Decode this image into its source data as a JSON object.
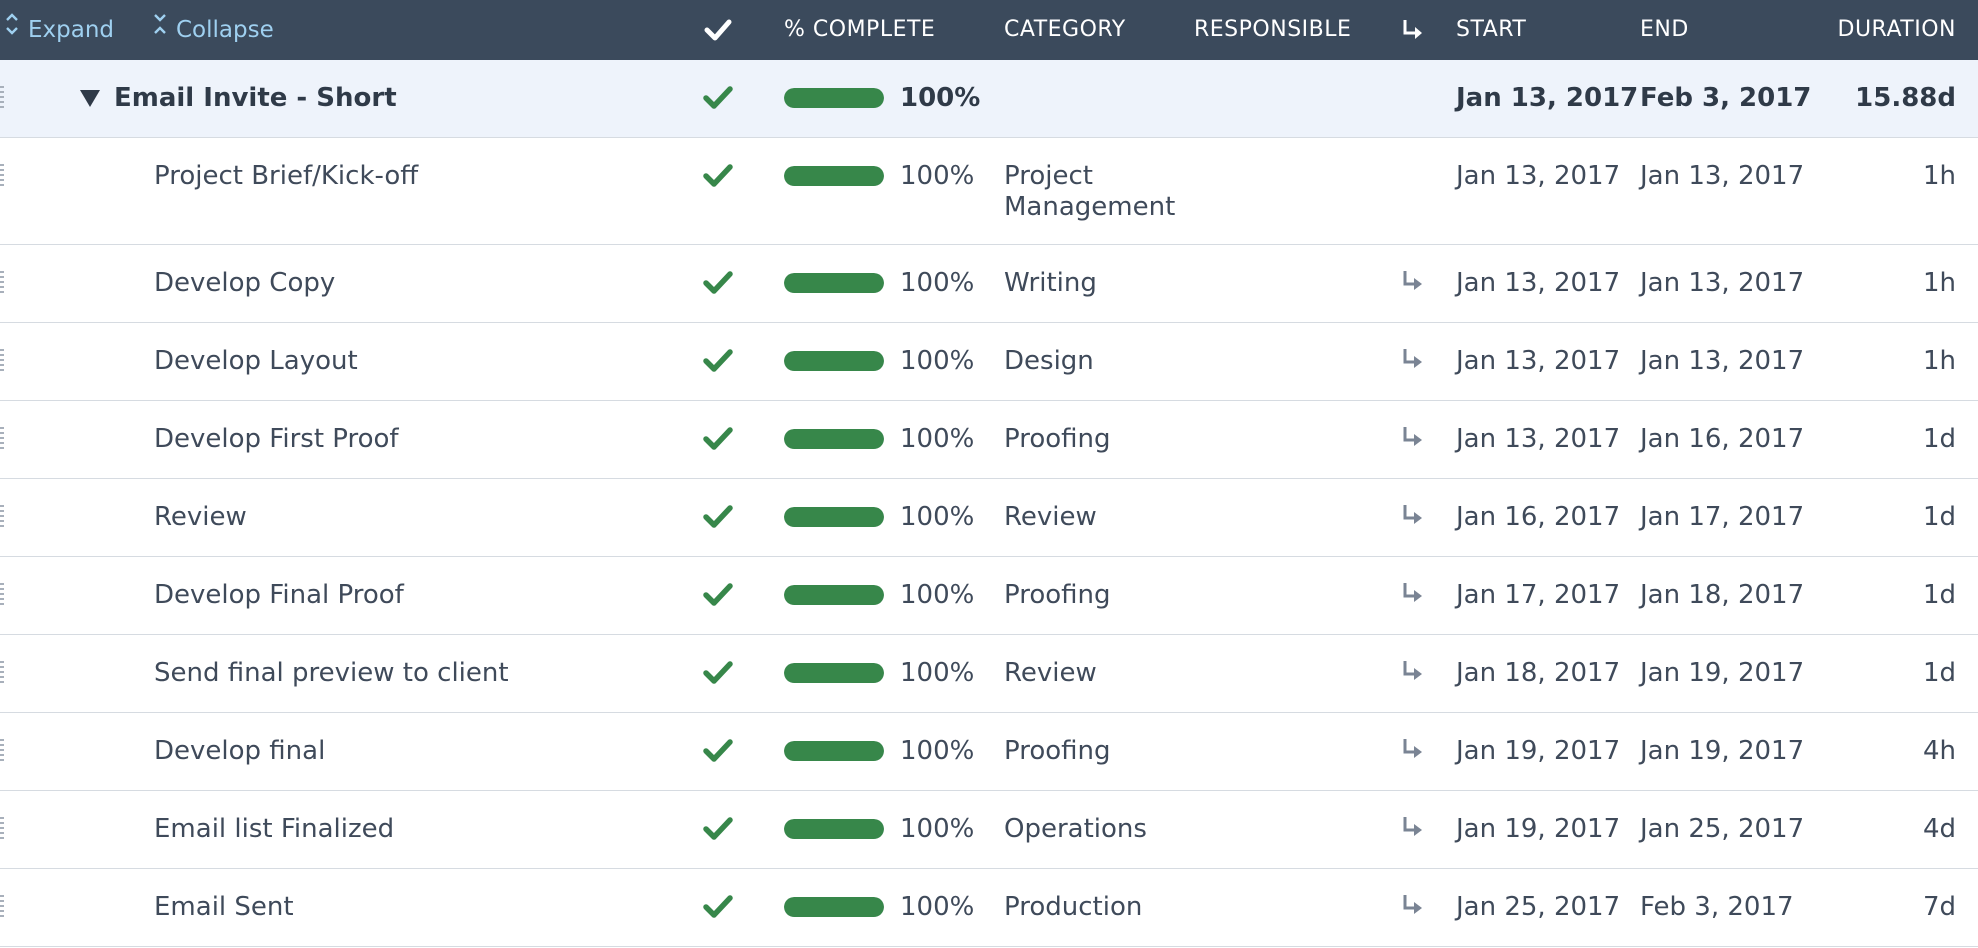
{
  "header": {
    "expand_label": "Expand",
    "collapse_label": "Collapse",
    "columns": {
      "percent_complete": "% COMPLETE",
      "category": "CATEGORY",
      "responsible": "RESPONSIBLE",
      "start": "START",
      "end": "END",
      "duration": "DURATION"
    }
  },
  "colors": {
    "header_bg": "#3b4a5c",
    "header_link": "#9fd0f0",
    "check_green": "#37874a",
    "progress_green": "#37874a",
    "group_row_bg": "#eef3fb",
    "dependency_icon": "#7a8494"
  },
  "icons": {
    "expand": "chevron-up-down-icon",
    "collapse": "chevrons-inward-icon",
    "done_header": "check-icon",
    "dependency_header": "dependency-arrow-icon",
    "row_done": "check-icon",
    "row_dependency": "dependency-arrow-icon",
    "group_toggle": "caret-down-icon"
  },
  "group": {
    "name": "Email Invite - Short",
    "complete": true,
    "progress": 100,
    "progress_label": "100%",
    "start": "Jan 13, 2017",
    "end": "Feb 3, 2017",
    "duration": "15.88d"
  },
  "tasks": [
    {
      "name": "Project Brief/Kick-off",
      "complete": true,
      "progress": 100,
      "progress_label": "100%",
      "category": [
        "Project",
        "Management"
      ],
      "dependency": false,
      "start": "Jan 13, 2017",
      "end": "Jan 13, 2017",
      "duration": "1h"
    },
    {
      "name": "Develop Copy",
      "complete": true,
      "progress": 100,
      "progress_label": "100%",
      "category": [
        "Writing"
      ],
      "dependency": true,
      "start": "Jan 13, 2017",
      "end": "Jan 13, 2017",
      "duration": "1h"
    },
    {
      "name": "Develop Layout",
      "complete": true,
      "progress": 100,
      "progress_label": "100%",
      "category": [
        "Design"
      ],
      "dependency": true,
      "start": "Jan 13, 2017",
      "end": "Jan 13, 2017",
      "duration": "1h"
    },
    {
      "name": "Develop First Proof",
      "complete": true,
      "progress": 100,
      "progress_label": "100%",
      "category": [
        "Proofing"
      ],
      "dependency": true,
      "start": "Jan 13, 2017",
      "end": "Jan 16, 2017",
      "duration": "1d"
    },
    {
      "name": "Review",
      "complete": true,
      "progress": 100,
      "progress_label": "100%",
      "category": [
        "Review"
      ],
      "dependency": true,
      "start": "Jan 16, 2017",
      "end": "Jan 17, 2017",
      "duration": "1d"
    },
    {
      "name": "Develop Final Proof",
      "complete": true,
      "progress": 100,
      "progress_label": "100%",
      "category": [
        "Proofing"
      ],
      "dependency": true,
      "start": "Jan 17, 2017",
      "end": "Jan 18, 2017",
      "duration": "1d"
    },
    {
      "name": "Send final preview to client",
      "complete": true,
      "progress": 100,
      "progress_label": "100%",
      "category": [
        "Review"
      ],
      "dependency": true,
      "start": "Jan 18, 2017",
      "end": "Jan 19, 2017",
      "duration": "1d"
    },
    {
      "name": "Develop final",
      "complete": true,
      "progress": 100,
      "progress_label": "100%",
      "category": [
        "Proofing"
      ],
      "dependency": true,
      "start": "Jan 19, 2017",
      "end": "Jan 19, 2017",
      "duration": "4h"
    },
    {
      "name": "Email list Finalized",
      "complete": true,
      "progress": 100,
      "progress_label": "100%",
      "category": [
        "Operations"
      ],
      "dependency": true,
      "start": "Jan 19, 2017",
      "end": "Jan 25, 2017",
      "duration": "4d"
    },
    {
      "name": "Email Sent",
      "complete": true,
      "progress": 100,
      "progress_label": "100%",
      "category": [
        "Production"
      ],
      "dependency": true,
      "start": "Jan 25, 2017",
      "end": "Feb 3, 2017",
      "duration": "7d"
    }
  ]
}
